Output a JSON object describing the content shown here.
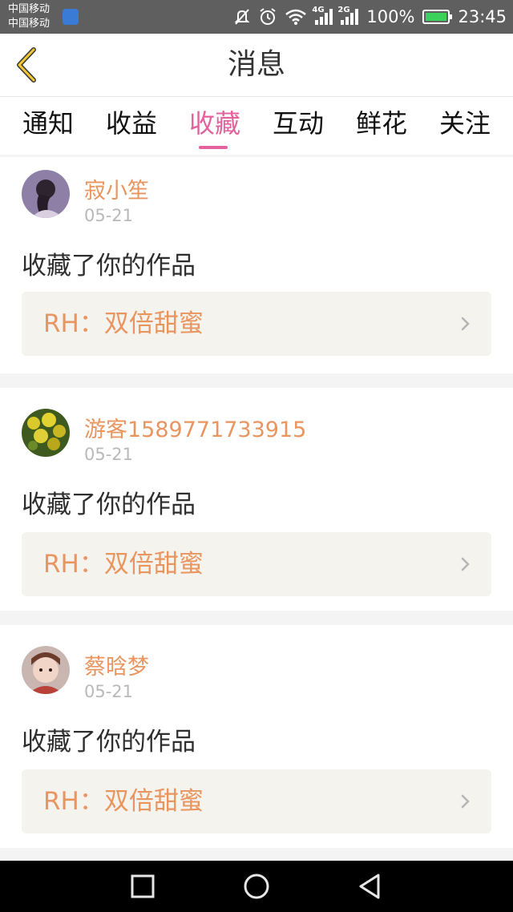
{
  "status_bar": {
    "carrier_1": "中国移动",
    "carrier_2": "中国移动",
    "network_1": "4G",
    "network_2": "2G",
    "battery": "100%",
    "battery_level": 1.0,
    "time": "23:45"
  },
  "header": {
    "title": "消息"
  },
  "tabs": [
    {
      "label": "通知"
    },
    {
      "label": "收益"
    },
    {
      "label": "收藏"
    },
    {
      "label": "互动"
    },
    {
      "label": "鲜花"
    },
    {
      "label": "关注"
    }
  ],
  "active_tab": "收藏",
  "accent_color": "#e3619c",
  "name_color": "#e9955f",
  "messages": [
    {
      "user": "寂小笙",
      "date": "05-21",
      "action": "收藏了你的作品",
      "work": "RH：双倍甜蜜"
    },
    {
      "user": "游客1589771733915",
      "date": "05-21",
      "action": "收藏了你的作品",
      "work": "RH：双倍甜蜜"
    },
    {
      "user": "蔡晗梦",
      "date": "05-21",
      "action": "收藏了你的作品",
      "work": "RH：双倍甜蜜"
    }
  ]
}
